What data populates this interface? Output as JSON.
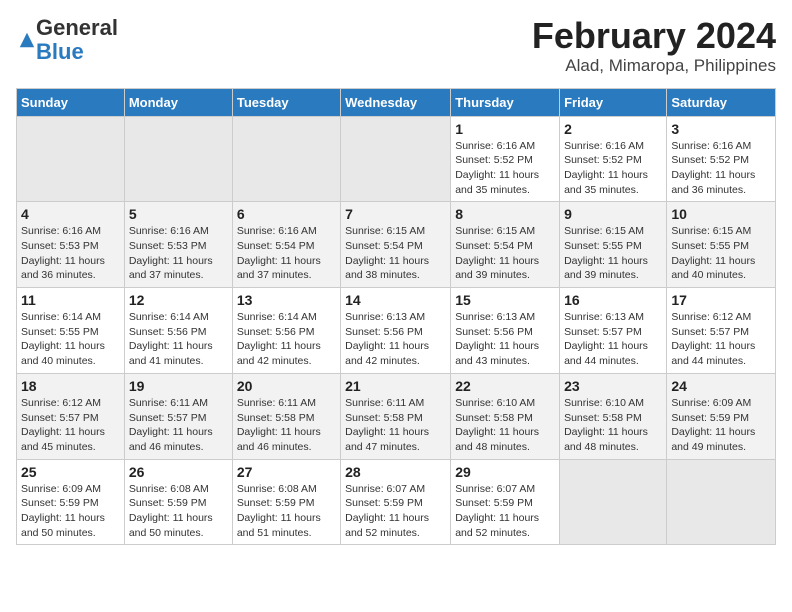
{
  "logo": {
    "general": "General",
    "blue": "Blue"
  },
  "title": "February 2024",
  "subtitle": "Alad, Mimaropa, Philippines",
  "days_of_week": [
    "Sunday",
    "Monday",
    "Tuesday",
    "Wednesday",
    "Thursday",
    "Friday",
    "Saturday"
  ],
  "weeks": [
    [
      {
        "day": "",
        "info": ""
      },
      {
        "day": "",
        "info": ""
      },
      {
        "day": "",
        "info": ""
      },
      {
        "day": "",
        "info": ""
      },
      {
        "day": "1",
        "info": "Sunrise: 6:16 AM\nSunset: 5:52 PM\nDaylight: 11 hours and 35 minutes."
      },
      {
        "day": "2",
        "info": "Sunrise: 6:16 AM\nSunset: 5:52 PM\nDaylight: 11 hours and 35 minutes."
      },
      {
        "day": "3",
        "info": "Sunrise: 6:16 AM\nSunset: 5:52 PM\nDaylight: 11 hours and 36 minutes."
      }
    ],
    [
      {
        "day": "4",
        "info": "Sunrise: 6:16 AM\nSunset: 5:53 PM\nDaylight: 11 hours and 36 minutes."
      },
      {
        "day": "5",
        "info": "Sunrise: 6:16 AM\nSunset: 5:53 PM\nDaylight: 11 hours and 37 minutes."
      },
      {
        "day": "6",
        "info": "Sunrise: 6:16 AM\nSunset: 5:54 PM\nDaylight: 11 hours and 37 minutes."
      },
      {
        "day": "7",
        "info": "Sunrise: 6:15 AM\nSunset: 5:54 PM\nDaylight: 11 hours and 38 minutes."
      },
      {
        "day": "8",
        "info": "Sunrise: 6:15 AM\nSunset: 5:54 PM\nDaylight: 11 hours and 39 minutes."
      },
      {
        "day": "9",
        "info": "Sunrise: 6:15 AM\nSunset: 5:55 PM\nDaylight: 11 hours and 39 minutes."
      },
      {
        "day": "10",
        "info": "Sunrise: 6:15 AM\nSunset: 5:55 PM\nDaylight: 11 hours and 40 minutes."
      }
    ],
    [
      {
        "day": "11",
        "info": "Sunrise: 6:14 AM\nSunset: 5:55 PM\nDaylight: 11 hours and 40 minutes."
      },
      {
        "day": "12",
        "info": "Sunrise: 6:14 AM\nSunset: 5:56 PM\nDaylight: 11 hours and 41 minutes."
      },
      {
        "day": "13",
        "info": "Sunrise: 6:14 AM\nSunset: 5:56 PM\nDaylight: 11 hours and 42 minutes."
      },
      {
        "day": "14",
        "info": "Sunrise: 6:13 AM\nSunset: 5:56 PM\nDaylight: 11 hours and 42 minutes."
      },
      {
        "day": "15",
        "info": "Sunrise: 6:13 AM\nSunset: 5:56 PM\nDaylight: 11 hours and 43 minutes."
      },
      {
        "day": "16",
        "info": "Sunrise: 6:13 AM\nSunset: 5:57 PM\nDaylight: 11 hours and 44 minutes."
      },
      {
        "day": "17",
        "info": "Sunrise: 6:12 AM\nSunset: 5:57 PM\nDaylight: 11 hours and 44 minutes."
      }
    ],
    [
      {
        "day": "18",
        "info": "Sunrise: 6:12 AM\nSunset: 5:57 PM\nDaylight: 11 hours and 45 minutes."
      },
      {
        "day": "19",
        "info": "Sunrise: 6:11 AM\nSunset: 5:57 PM\nDaylight: 11 hours and 46 minutes."
      },
      {
        "day": "20",
        "info": "Sunrise: 6:11 AM\nSunset: 5:58 PM\nDaylight: 11 hours and 46 minutes."
      },
      {
        "day": "21",
        "info": "Sunrise: 6:11 AM\nSunset: 5:58 PM\nDaylight: 11 hours and 47 minutes."
      },
      {
        "day": "22",
        "info": "Sunrise: 6:10 AM\nSunset: 5:58 PM\nDaylight: 11 hours and 48 minutes."
      },
      {
        "day": "23",
        "info": "Sunrise: 6:10 AM\nSunset: 5:58 PM\nDaylight: 11 hours and 48 minutes."
      },
      {
        "day": "24",
        "info": "Sunrise: 6:09 AM\nSunset: 5:59 PM\nDaylight: 11 hours and 49 minutes."
      }
    ],
    [
      {
        "day": "25",
        "info": "Sunrise: 6:09 AM\nSunset: 5:59 PM\nDaylight: 11 hours and 50 minutes."
      },
      {
        "day": "26",
        "info": "Sunrise: 6:08 AM\nSunset: 5:59 PM\nDaylight: 11 hours and 50 minutes."
      },
      {
        "day": "27",
        "info": "Sunrise: 6:08 AM\nSunset: 5:59 PM\nDaylight: 11 hours and 51 minutes."
      },
      {
        "day": "28",
        "info": "Sunrise: 6:07 AM\nSunset: 5:59 PM\nDaylight: 11 hours and 52 minutes."
      },
      {
        "day": "29",
        "info": "Sunrise: 6:07 AM\nSunset: 5:59 PM\nDaylight: 11 hours and 52 minutes."
      },
      {
        "day": "",
        "info": ""
      },
      {
        "day": "",
        "info": ""
      }
    ]
  ]
}
